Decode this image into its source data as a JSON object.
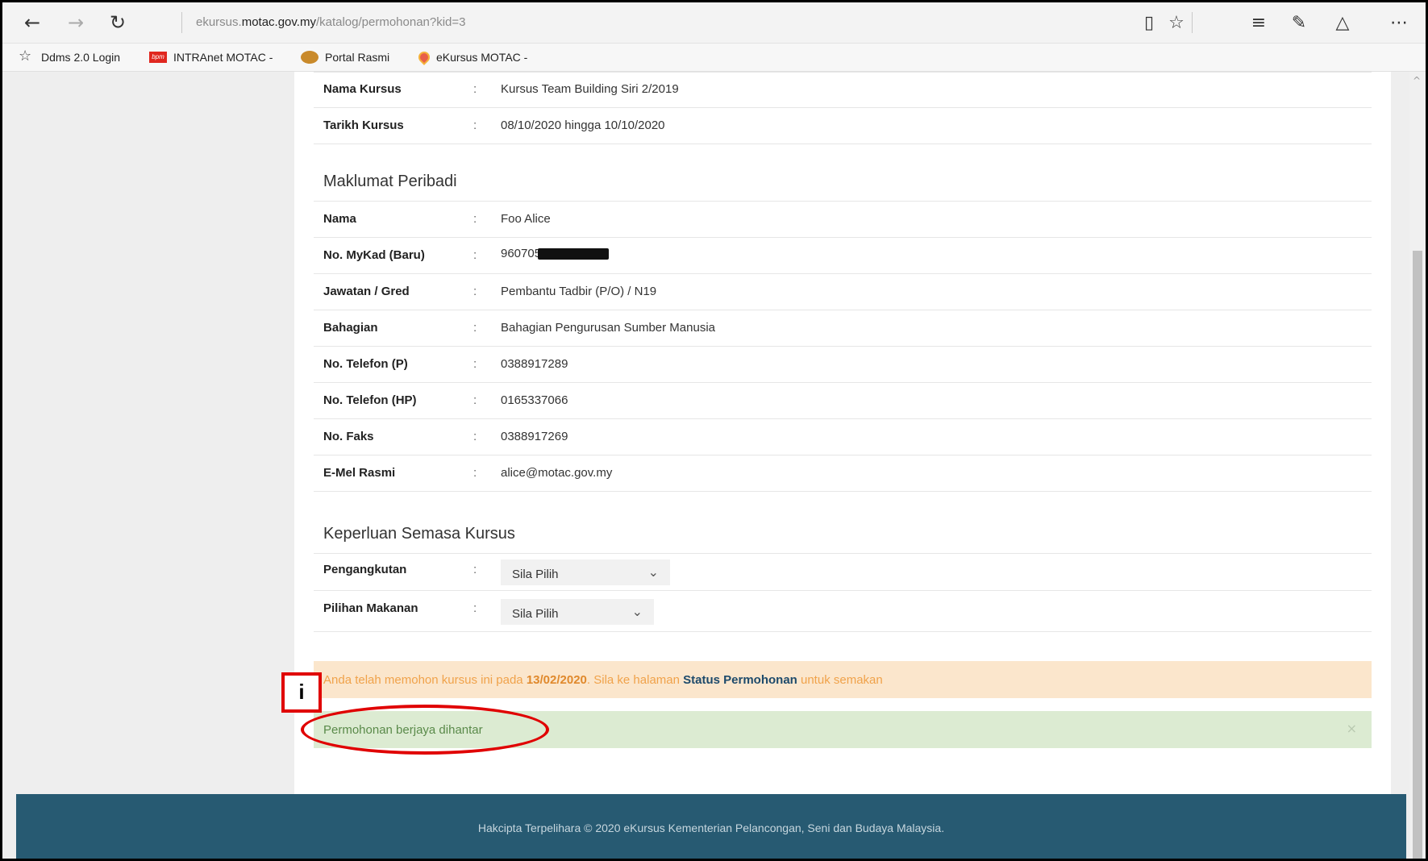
{
  "browser": {
    "url_prefix": "ekursus.",
    "url_domain": "motac.gov.my",
    "url_path": "/katalog/permohonan?kid=3",
    "favorites": [
      {
        "label": "Ddms 2.0 Login",
        "icon": "star-icon"
      },
      {
        "label": "INTRAnet MOTAC -",
        "icon": "bpm-logo-icon"
      },
      {
        "label": "Portal Rasmi",
        "icon": "crest-icon"
      },
      {
        "label": "eKursus MOTAC -",
        "icon": "location-pin-icon"
      }
    ],
    "bpm_icon_text": "bpm"
  },
  "course": {
    "rows": [
      {
        "label": "Nama Kursus",
        "value": "Kursus Team Building Siri 2/2019"
      },
      {
        "label": "Tarikh Kursus",
        "value": "08/10/2020 hingga 10/10/2020"
      }
    ]
  },
  "personal": {
    "title": "Maklumat Peribadi",
    "rows": [
      {
        "label": "Nama",
        "value": "Foo Alice"
      },
      {
        "label": "No. MyKad (Baru)",
        "value": "960705"
      },
      {
        "label": "Jawatan / Gred",
        "value": "Pembantu Tadbir (P/O) / N19"
      },
      {
        "label": "Bahagian",
        "value": "Bahagian Pengurusan Sumber Manusia"
      },
      {
        "label": "No. Telefon (P)",
        "value": "0388917289"
      },
      {
        "label": "No. Telefon (HP)",
        "value": "0165337066"
      },
      {
        "label": "No. Faks",
        "value": "0388917269"
      },
      {
        "label": "E-Mel Rasmi",
        "value": "alice@motac.gov.my"
      }
    ]
  },
  "needs": {
    "title": "Keperluan Semasa Kursus",
    "rows": [
      {
        "label": "Pengangkutan",
        "selected": "Sila Pilih"
      },
      {
        "label": "Pilihan Makanan",
        "selected": "Sila Pilih"
      }
    ]
  },
  "colon": ":",
  "alerts": {
    "warning_pre": "Anda telah memohon kursus ini pada ",
    "warning_date": "13/02/2020",
    "warning_mid": ". Sila ke halaman ",
    "warning_link": "Status Permohonan",
    "warning_post": " untuk semakan",
    "success": "Permohonan berjaya dihantar",
    "close_glyph": "×"
  },
  "footer": {
    "text": "Hakcipta Terpelihara © 2020 eKursus Kementerian Pelancongan, Seni dan Budaya Malaysia."
  },
  "annotation": {
    "label": "i"
  }
}
